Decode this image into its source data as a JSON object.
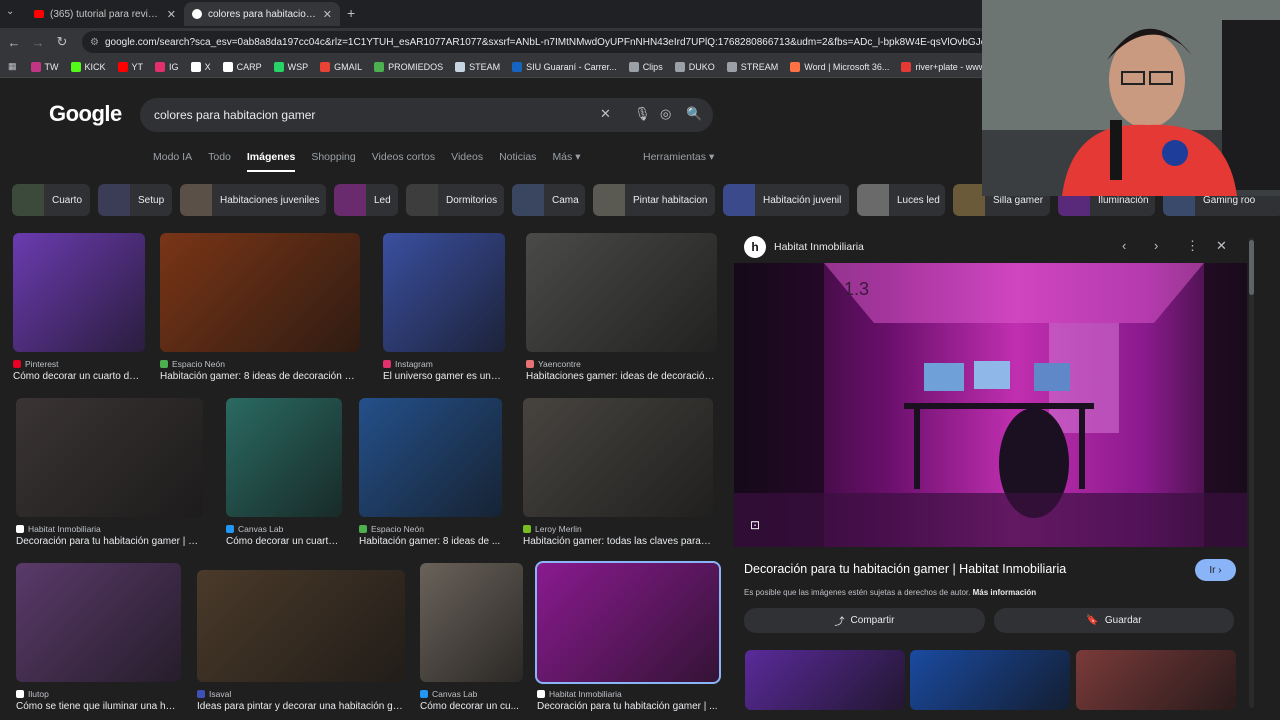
{
  "tabs": [
    {
      "title": "(365) tutorial para revivir a tu h",
      "active": false
    },
    {
      "title": "colores para habitacion gamer",
      "active": true
    }
  ],
  "url": "google.com/search?sca_esv=0ab8a8da197cc04c&rlz=1C1YTUH_esAR1077AR1077&sxsrf=ANbL-n7IMtNMwdOyUPFnNHN43eIrd7UPlQ:1768280866713&udm=2&fbs=ADc_l-bpk8W4E-qsVlOvbGJcDwpn60DczFdcvP",
  "bookmarks": [
    {
      "label": "TW",
      "color": "#c13584"
    },
    {
      "label": "KICK",
      "color": "#53fc18"
    },
    {
      "label": "YT",
      "color": "#ff0000"
    },
    {
      "label": "IG",
      "color": "#e1306c"
    },
    {
      "label": "X",
      "color": "#ffffff"
    },
    {
      "label": "CARP",
      "color": "#ffffff"
    },
    {
      "label": "WSP",
      "color": "#25d366"
    },
    {
      "label": "GMAIL",
      "color": "#ea4335"
    },
    {
      "label": "PROMIEDOS",
      "color": "#4caf50"
    },
    {
      "label": "STEAM",
      "color": "#c7d5e0"
    },
    {
      "label": "SIU Guaraní - Carrer...",
      "color": "#1565c0"
    },
    {
      "label": "Clips",
      "color": "#9aa0a6"
    },
    {
      "label": "DUKO",
      "color": "#9aa0a6"
    },
    {
      "label": "STREAM",
      "color": "#9aa0a6"
    },
    {
      "label": "Word | Microsoft 36...",
      "color": "#ff7043"
    },
    {
      "label": "river+plate - www.s...",
      "color": "#e53935"
    },
    {
      "label": "Retro Co",
      "color": "#e53935"
    }
  ],
  "logo": "Google",
  "query": "colores para habitacion gamer",
  "filters": [
    "Modo IA",
    "Todo",
    "Imágenes",
    "Shopping",
    "Videos cortos",
    "Videos",
    "Noticias",
    "Más"
  ],
  "selected_filter": "Imágenes",
  "tools": "Herramientas",
  "chips": [
    {
      "label": "Cuarto",
      "color": "#3b4a3a"
    },
    {
      "label": "Setup",
      "color": "#3a3d55"
    },
    {
      "label": "Habitaciones juveniles",
      "color": "#5a5047"
    },
    {
      "label": "Led",
      "color": "#6a2a6e"
    },
    {
      "label": "Dormitorios",
      "color": "#3d3d3d"
    },
    {
      "label": "Cama",
      "color": "#3a4660"
    },
    {
      "label": "Pintar habitacion",
      "color": "#5a5a52"
    },
    {
      "label": "Habitación juvenil",
      "color": "#3a4a8a"
    },
    {
      "label": "Luces led",
      "color": "#6a6a6a"
    },
    {
      "label": "Silla gamer",
      "color": "#6a5a3a"
    },
    {
      "label": "Iluminación",
      "color": "#5a2a7a"
    },
    {
      "label": "Gaming roo",
      "color": "#3a4a6a"
    }
  ],
  "results": [
    {
      "source": "Pinterest",
      "caption": "Cómo decorar un cuarto de...",
      "color": "#6b3bb0",
      "icon": "#e60023"
    },
    {
      "source": "Espacio Neón",
      "caption": "Habitación gamer: 8 ideas de decoración pa...",
      "color": "#7a3516",
      "icon": "#4caf50"
    },
    {
      "source": "Instagram",
      "caption": "El universo gamer es una t...",
      "color": "#3a4fa0",
      "icon": "#e1306c"
    },
    {
      "source": "Yaencontre",
      "caption": "Habitaciones gamer: ideas de decoración ...",
      "color": "#4a4a48",
      "icon": "#e57373"
    },
    {
      "source": "Habitat Inmobiliaria",
      "caption": "Decoración para tu habitación gamer | Ha...",
      "color": "#3a3434",
      "icon": "#ffffff"
    },
    {
      "source": "Canvas Lab",
      "caption": "Cómo decorar un cuarto ...",
      "color": "#2a6a62",
      "icon": "#2196f3"
    },
    {
      "source": "Espacio Neón",
      "caption": "Habitación gamer: 8 ideas de ...",
      "color": "#24508a",
      "icon": "#4caf50"
    },
    {
      "source": "Leroy Merlin",
      "caption": "Habitación gamer: todas las claves para de...",
      "color": "#474440",
      "icon": "#78be20"
    },
    {
      "source": "Ilutop",
      "caption": "Cómo se tiene que iluminar una hab...",
      "color": "#5a3a6a",
      "icon": "#ffffff"
    },
    {
      "source": "Isaval",
      "caption": "Ideas para pintar y decorar una habitación ga...",
      "color": "#4a3a2a",
      "icon": "#3f51b5"
    },
    {
      "source": "Canvas Lab",
      "caption": "Cómo decorar un cu...",
      "color": "#6a625a",
      "icon": "#2196f3"
    },
    {
      "source": "Habitat Inmobiliaria",
      "caption": "Decoración para tu habitación gamer | ...",
      "color": "#8a1a90",
      "icon": "#ffffff"
    }
  ],
  "panel": {
    "source": "Habitat Inmobiliaria",
    "logo_letter": "h",
    "title": "Decoración para tu habitación gamer | Habitat Inmobiliaria",
    "visit_label": "Ir",
    "copyright_note": "Es posible que las imágenes estén sujetas a derechos de autor.",
    "more_info": "Más información",
    "share_label": "Compartir",
    "save_label": "Guardar",
    "related_colors": [
      "#5a2a9a",
      "#1a4aa0",
      "#7a3a3a"
    ]
  },
  "accent": "#8ab4f8"
}
